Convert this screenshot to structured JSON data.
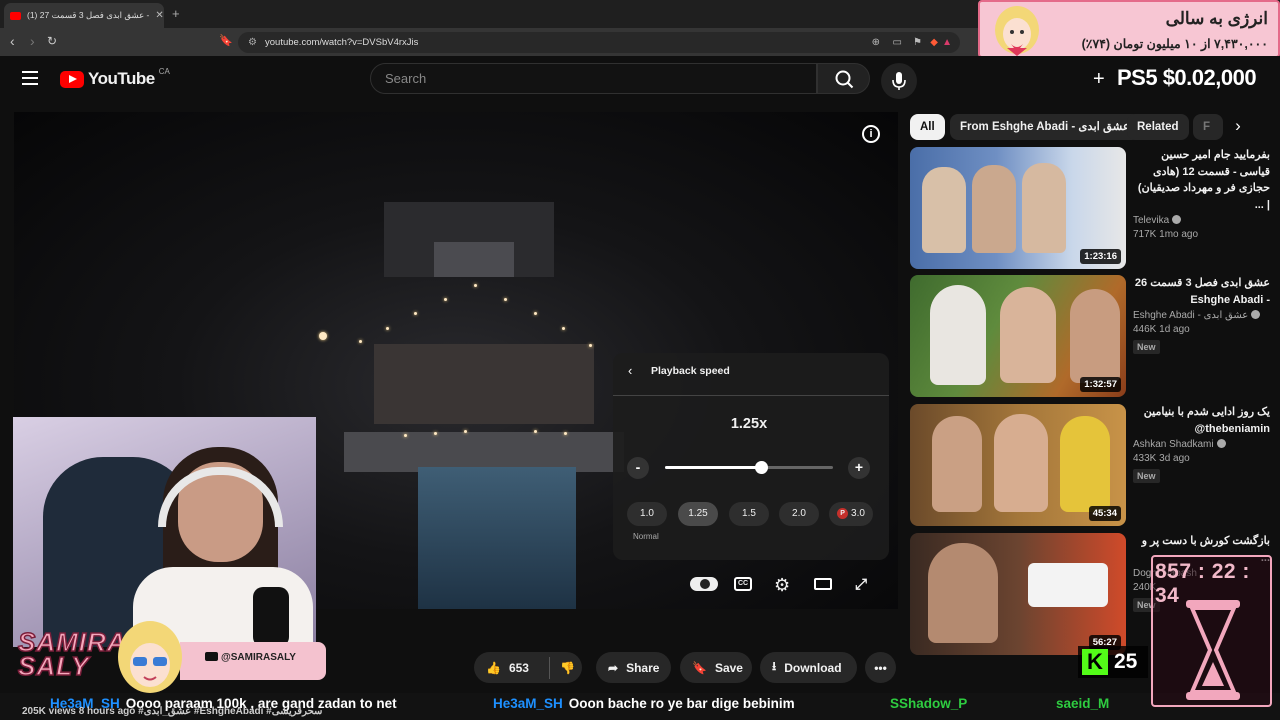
{
  "browser": {
    "tab_title": "(1) عشق ابدی فصل 3 قسمت 27 -",
    "url": "youtube.com/watch?v=DVSbV4rxJis"
  },
  "promo": {
    "title": "انرژی به سالی",
    "subtitle": "۷,۴۳۰,۰۰۰ از ۱۰ میلیون تومان (۷۴٪)"
  },
  "header": {
    "logo_text": "YouTube",
    "country_code": "CA",
    "search_placeholder": "Search",
    "donation_text": "PS5 $0.02,000"
  },
  "speed_panel": {
    "title": "Playback speed",
    "current": "1.25x",
    "minus": "-",
    "plus": "+",
    "level_fraction": 0.57,
    "presets": [
      "1.0",
      "1.25",
      "1.5",
      "2.0",
      "3.0"
    ],
    "normal_label": "Normal"
  },
  "controls": {
    "cc": "CC"
  },
  "streamer": {
    "name_line1": "SAMIRA",
    "name_line2": "SALY",
    "social": "@SAMIRASALY"
  },
  "actions": {
    "likes": "653",
    "share": "Share",
    "save": "Save",
    "download": "Download",
    "more": "•••"
  },
  "ticker": {
    "views": "205K views  8 hours ago  #عشق_ابدی #EshgheAbadi  #سحرقریشی",
    "messages": [
      {
        "user": "He3aM_SH",
        "text": "Oooo paraam 100k , are gand zadan to net"
      },
      {
        "user": "He3aM_SH",
        "text": "Ooon bache ro ye bar dige bebinim"
      },
      {
        "user": "SShadow_P",
        "text": ""
      },
      {
        "user": "saeid_M",
        "text": ""
      }
    ]
  },
  "filters": [
    "All",
    "From Eshghe Abadi - عشق ابدی",
    "Related",
    "F"
  ],
  "videos": [
    {
      "title": "بفرمایید جام امیر حسین قیاسی - قسمت 12 (هادی حجازی فر و مهرداد صدیقیان) | ...",
      "channel": "Televika",
      "stats": "717K  1mo ago",
      "duration": "1:23:16",
      "new": ""
    },
    {
      "title": "عشق ابدی فصل 3 قسمت 26 - Eshghe Abadi",
      "channel": "Eshghe Abadi - عشق ابدی",
      "stats": "446K  1d ago",
      "duration": "1:32:57",
      "new": "New"
    },
    {
      "title": "یک روز ادایی شدم با بنیامین thebeniamin@",
      "channel": "Ashkan Shadkami",
      "stats": "433K  3d ago",
      "duration": "45:34",
      "new": "New"
    },
    {
      "title": "بازگشت کورش با دست پر و ...",
      "channel": "Dogm Nabash",
      "stats": "240K",
      "duration": "56:27",
      "new": "New"
    }
  ],
  "timer": "857 : 22 : 34",
  "kick": {
    "logo": "K",
    "count": "25"
  },
  "colors": {
    "accent_red": "#ff0000",
    "kick_green": "#53fc18",
    "promo_pink": "#f7c6d3"
  }
}
